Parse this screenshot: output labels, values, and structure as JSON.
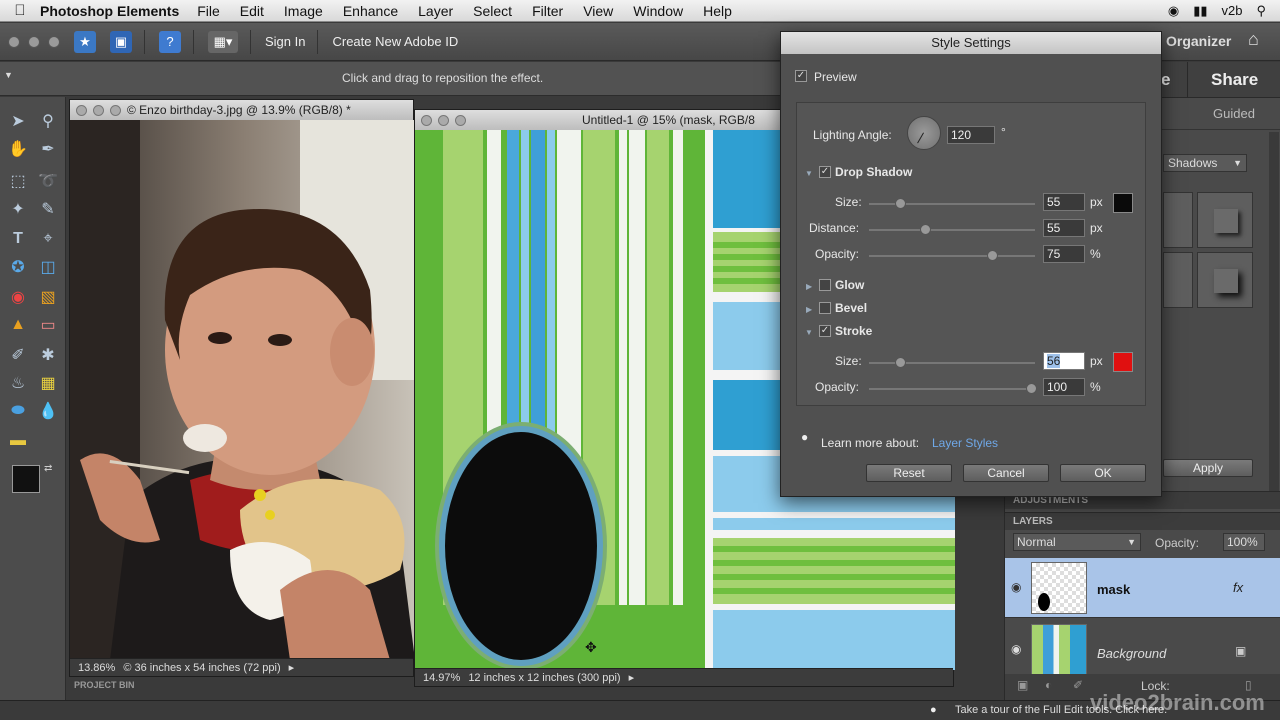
{
  "menubar": {
    "app_name": "Photoshop Elements",
    "items": [
      "File",
      "Edit",
      "Image",
      "Enhance",
      "Layer",
      "Select",
      "Filter",
      "View",
      "Window",
      "Help"
    ],
    "user": "v2b"
  },
  "toolbar": {
    "sign_in": "Sign In",
    "create_id": "Create New Adobe ID",
    "organizer": "Organizer"
  },
  "options_bar": {
    "hint": "Click and drag to reposition the effect."
  },
  "doc_photo": {
    "title": "© Enzo birthday-3.jpg @ 13.9% (RGB/8) *",
    "zoom": "13.86%",
    "info": "© 36 inches x 54 inches (72 ppi)"
  },
  "doc_pattern": {
    "title": "Untitled-1 @ 15% (mask, RGB/8",
    "zoom": "14.97%",
    "info": "12 inches x 12 inches (300 ppi)"
  },
  "project_bin": "PROJECT BIN",
  "right_panel": {
    "tab_create": "e",
    "tab_share": "Share",
    "guided": "Guided",
    "effects_dropdown": "Shadows",
    "apply": "Apply",
    "adjustments": "ADJUSTMENTS",
    "layers_header": "LAYERS",
    "blend_mode": "Normal",
    "opacity_label": "Opacity:",
    "opacity_value": "100%",
    "lock_label": "Lock:",
    "layers": [
      {
        "name": "mask",
        "fx": "fx"
      },
      {
        "name": "Background"
      }
    ]
  },
  "dialog": {
    "title": "Style Settings",
    "preview": "Preview",
    "lighting_angle_label": "Lighting Angle:",
    "lighting_angle": "120",
    "degree": "°",
    "drop_shadow": {
      "label": "Drop Shadow",
      "size_label": "Size:",
      "size": "55",
      "size_unit": "px",
      "distance_label": "Distance:",
      "distance": "55",
      "distance_unit": "px",
      "opacity_label": "Opacity:",
      "opacity": "75",
      "opacity_unit": "%",
      "color": "#0a0a0a"
    },
    "glow": "Glow",
    "bevel": "Bevel",
    "stroke": {
      "label": "Stroke",
      "size_label": "Size:",
      "size": "56",
      "size_unit": "px",
      "opacity_label": "Opacity:",
      "opacity": "100",
      "opacity_unit": "%",
      "color": "#e01010"
    },
    "learn_more": "Learn more about:",
    "learn_link": "Layer Styles",
    "reset": "Reset",
    "cancel": "Cancel",
    "ok": "OK"
  },
  "bottom_tip": "Take a tour of the Full Edit tools. Click here.",
  "watermark": "video2brain.com"
}
